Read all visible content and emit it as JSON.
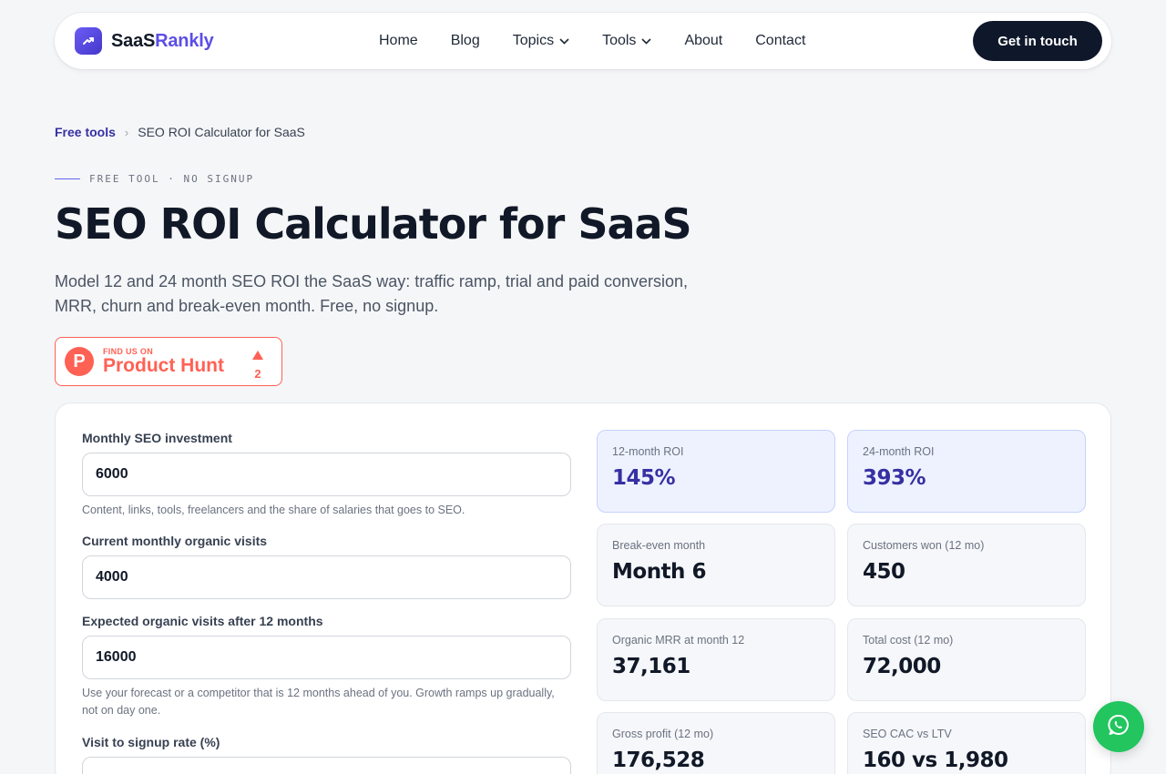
{
  "nav": {
    "logo_part1": "SaaS",
    "logo_part2": "Rankly",
    "items": [
      {
        "label": "Home"
      },
      {
        "label": "Blog"
      },
      {
        "label": "Topics"
      },
      {
        "label": "Tools"
      },
      {
        "label": "About"
      },
      {
        "label": "Contact"
      }
    ],
    "cta_label": "Get in touch"
  },
  "breadcrumb": {
    "parent": "Free tools",
    "separator": "›",
    "current": "SEO ROI Calculator for SaaS"
  },
  "hero": {
    "eyebrow": "FREE TOOL · NO SIGNUP",
    "title": "SEO ROI Calculator for SaaS",
    "lead": "Model 12 and 24 month SEO ROI the SaaS way: traffic ramp, trial and paid conversion, MRR, churn and break-even month. Free, no signup."
  },
  "product_hunt": {
    "small": "FIND US ON",
    "big": "Product Hunt",
    "votes": "2"
  },
  "form": {
    "fields": [
      {
        "label": "Monthly SEO investment",
        "value": "6000",
        "help": "Content, links, tools, freelancers and the share of salaries that goes to SEO."
      },
      {
        "label": "Current monthly organic visits",
        "value": "4000",
        "help": ""
      },
      {
        "label": "Expected organic visits after 12 months",
        "value": "16000",
        "help": "Use your forecast or a competitor that is 12 months ahead of you. Growth ramps up gradually, not on day one."
      },
      {
        "label": "Visit to signup rate (%)",
        "value": "",
        "help": ""
      }
    ]
  },
  "results": [
    {
      "label": "12-month ROI",
      "value": "145%"
    },
    {
      "label": "24-month ROI",
      "value": "393%"
    },
    {
      "label": "Break-even month",
      "value": "Month 6"
    },
    {
      "label": "Customers won (12 mo)",
      "value": "450"
    },
    {
      "label": "Organic MRR at month 12",
      "value": "37,161"
    },
    {
      "label": "Total cost (12 mo)",
      "value": "72,000"
    },
    {
      "label": "Gross profit (12 mo)",
      "value": "176,528"
    },
    {
      "label": "SEO CAC vs LTV",
      "value": "160 vs 1,980"
    }
  ],
  "colors": {
    "brand": "#5b4ee6",
    "dark": "#0f172a",
    "product_hunt": "#ff6154",
    "whatsapp": "#22c55e"
  }
}
